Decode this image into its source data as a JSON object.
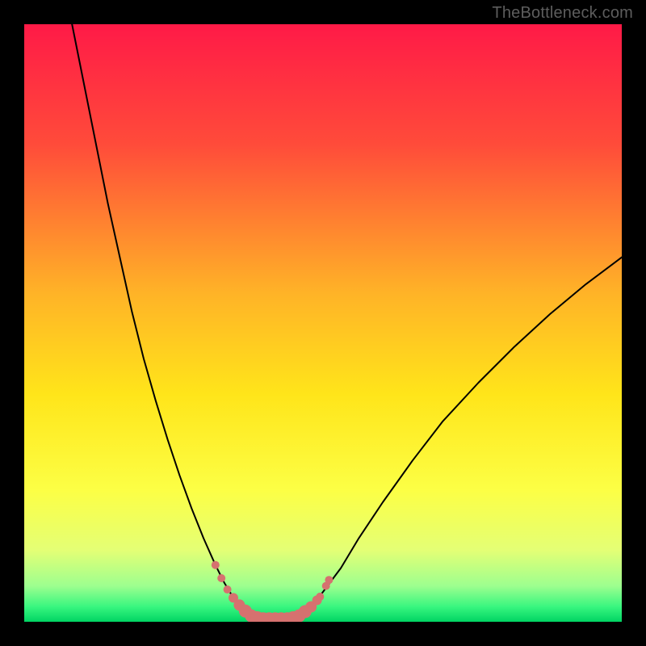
{
  "watermark": "TheBottleneck.com",
  "chart_data": {
    "type": "line",
    "title": "",
    "xlabel": "",
    "ylabel": "",
    "xlim": [
      0,
      100
    ],
    "ylim": [
      0,
      100
    ],
    "grid": false,
    "legend": false,
    "gradient_stops": [
      {
        "offset": 0.0,
        "color": "#ff1a47"
      },
      {
        "offset": 0.2,
        "color": "#ff4b3a"
      },
      {
        "offset": 0.45,
        "color": "#ffb327"
      },
      {
        "offset": 0.62,
        "color": "#ffe51a"
      },
      {
        "offset": 0.78,
        "color": "#fcff45"
      },
      {
        "offset": 0.88,
        "color": "#e4ff75"
      },
      {
        "offset": 0.94,
        "color": "#9dff8f"
      },
      {
        "offset": 0.975,
        "color": "#38f67f"
      },
      {
        "offset": 1.0,
        "color": "#00d463"
      }
    ],
    "series": [
      {
        "name": "left-branch",
        "x": [
          8,
          10,
          12,
          14,
          16,
          18,
          20,
          22,
          24,
          26,
          28,
          30,
          32,
          33.5,
          35,
          36.5,
          38
        ],
        "y": [
          100,
          90,
          80,
          70,
          61,
          52,
          44,
          37,
          30.5,
          24.5,
          19,
          14,
          9.5,
          6.5,
          4,
          2,
          1
        ]
      },
      {
        "name": "valley-floor",
        "x": [
          38,
          40,
          42,
          44,
          46
        ],
        "y": [
          1,
          0.5,
          0.5,
          0.5,
          1
        ]
      },
      {
        "name": "right-branch",
        "x": [
          46,
          48,
          50,
          53,
          56,
          60,
          65,
          70,
          76,
          82,
          88,
          94,
          100
        ],
        "y": [
          1,
          2.5,
          5,
          9,
          14,
          20,
          27,
          33.5,
          40,
          46,
          51.5,
          56.5,
          61
        ]
      }
    ],
    "markers": {
      "name": "highlight-dots",
      "color": "#d6716f",
      "radius_seq": [
        5,
        5,
        5,
        6,
        7,
        8,
        8,
        8,
        8,
        8,
        8,
        8,
        8,
        8,
        8,
        8,
        7,
        6,
        5,
        5,
        5
      ],
      "points": [
        {
          "x": 32.0,
          "y": 9.5
        },
        {
          "x": 33.0,
          "y": 7.3
        },
        {
          "x": 34.0,
          "y": 5.4
        },
        {
          "x": 35.0,
          "y": 4.0
        },
        {
          "x": 36.0,
          "y": 2.8
        },
        {
          "x": 37.0,
          "y": 1.8
        },
        {
          "x": 38.0,
          "y": 1.0
        },
        {
          "x": 39.0,
          "y": 0.7
        },
        {
          "x": 40.0,
          "y": 0.5
        },
        {
          "x": 41.0,
          "y": 0.5
        },
        {
          "x": 42.0,
          "y": 0.5
        },
        {
          "x": 43.0,
          "y": 0.5
        },
        {
          "x": 44.0,
          "y": 0.5
        },
        {
          "x": 45.0,
          "y": 0.7
        },
        {
          "x": 46.0,
          "y": 1.0
        },
        {
          "x": 47.0,
          "y": 1.7
        },
        {
          "x": 48.0,
          "y": 2.5
        },
        {
          "x": 49.0,
          "y": 3.6
        },
        {
          "x": 49.5,
          "y": 4.2
        },
        {
          "x": 50.5,
          "y": 6.0
        },
        {
          "x": 51.0,
          "y": 7.0
        }
      ]
    }
  }
}
